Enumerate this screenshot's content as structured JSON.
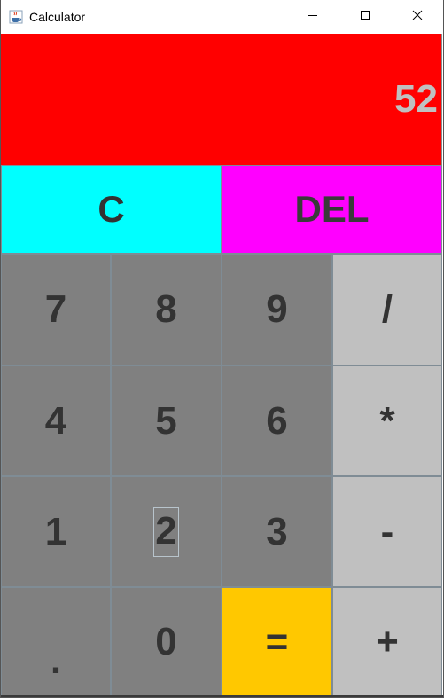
{
  "window": {
    "title": "Calculator",
    "controls": {
      "minimize": "─",
      "maximize": "☐",
      "close": "✕"
    }
  },
  "display": {
    "value": "52",
    "background": "#ff0000",
    "text_color": "#c0c0c0"
  },
  "top_buttons": {
    "clear": "C",
    "delete": "DEL"
  },
  "keys": {
    "seven": "7",
    "eight": "8",
    "nine": "9",
    "divide": "/",
    "four": "4",
    "five": "5",
    "six": "6",
    "multiply": "*",
    "one": "1",
    "two": "2",
    "three": "3",
    "subtract": "-",
    "decimal": ".",
    "zero": "0",
    "equals": "=",
    "add": "+"
  },
  "colors": {
    "clear_bg": "#00ffff",
    "delete_bg": "#ff00ff",
    "digit_bg": "#808080",
    "operator_bg": "#c0c0c0",
    "equals_bg": "#ffc800"
  }
}
